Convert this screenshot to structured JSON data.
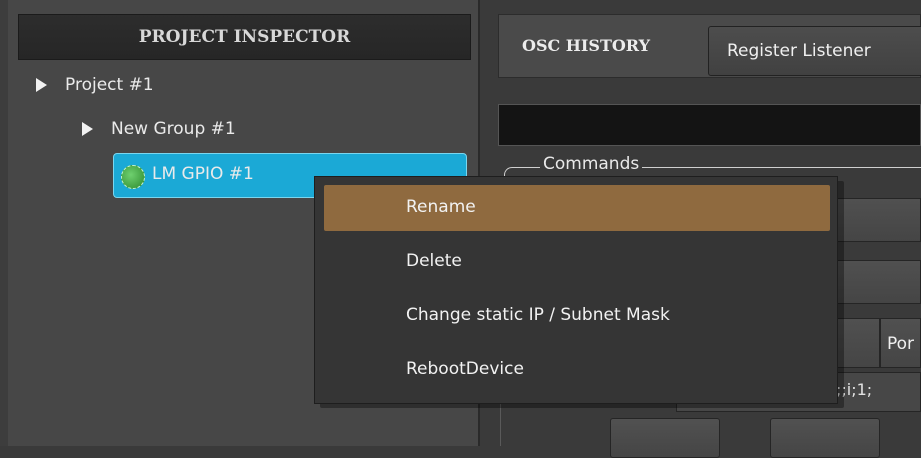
{
  "inspector": {
    "title": "PROJECT INSPECTOR",
    "tree": [
      {
        "label": "Project #1"
      },
      {
        "label": "New Group #1"
      },
      {
        "label": "LM GPIO #1",
        "selected": true
      }
    ]
  },
  "osc": {
    "title": "OSC HISTORY",
    "register_button": "Register Listener",
    "commands_group_label": "Commands",
    "port_label_partial": "Por",
    "command_value_partial": ";;i;1;"
  },
  "context_menu": {
    "items": [
      {
        "label": "Rename",
        "highlighted": true
      },
      {
        "label": "Delete"
      },
      {
        "label": "Change static IP / Subnet Mask"
      },
      {
        "label": "RebootDevice"
      }
    ]
  },
  "colors": {
    "selection": "#1ba9d6",
    "menu_highlight": "#8f6a3f",
    "panel_bg": "#474747"
  }
}
